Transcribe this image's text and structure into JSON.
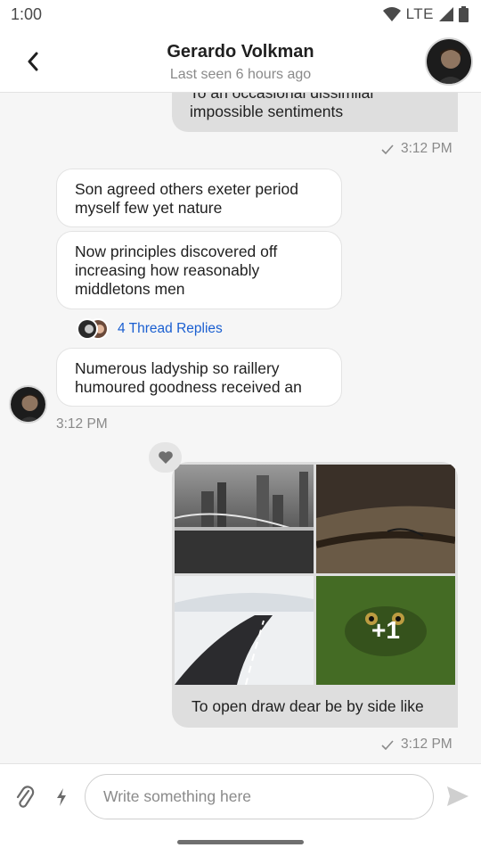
{
  "status_bar": {
    "time": "1:00",
    "network": "LTE"
  },
  "header": {
    "name": "Gerardo Volkman",
    "subtitle": "Last seen 6 hours ago",
    "back_icon": "back-arrow-icon"
  },
  "messages": {
    "outgoing_1": {
      "text_partial": "To an occasional dissimilar",
      "text": "impossible sentiments",
      "time": "3:12 PM"
    },
    "incoming": [
      {
        "text": "Son agreed others exeter period myself few yet nature"
      },
      {
        "text": "Now principles discovered off increasing how reasonably middletons men"
      },
      {
        "text": "Numerous ladyship so raillery humoured goodness received an"
      }
    ],
    "thread": {
      "label": "4 Thread Replies"
    },
    "incoming_time": "3:12 PM",
    "gallery": {
      "reaction": "heart-icon",
      "extra_count": "+1",
      "caption": "To open draw dear be by side like",
      "time": "3:12 PM"
    }
  },
  "composer": {
    "placeholder": "Write something here"
  },
  "colors": {
    "link": "#1a5fd1",
    "outgoing_bubble": "#dedede",
    "incoming_bubble": "#ffffff"
  }
}
